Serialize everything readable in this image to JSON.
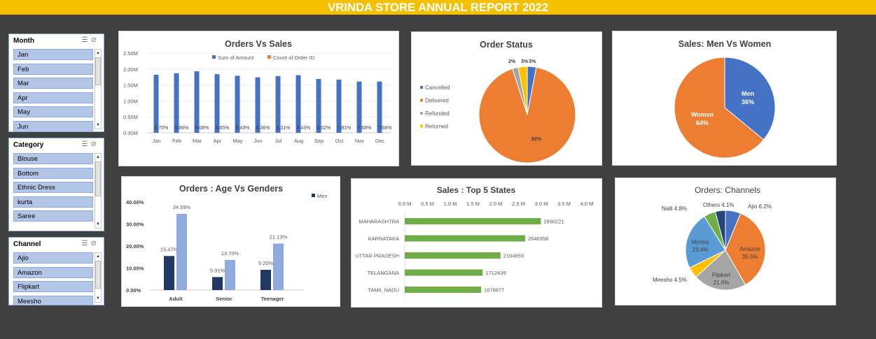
{
  "report": {
    "title": "VRINDA STORE ANNUAL REPORT 2022"
  },
  "colors": {
    "blue": "#4472c4",
    "orange": "#ed7d31",
    "gray": "#a5a5a5",
    "gold": "#ffc000",
    "navy": "#203864",
    "lightblue": "#8faadc",
    "green": "#70ad47",
    "header": "#f5c000",
    "background": "#404040"
  },
  "slicers": {
    "month": {
      "title": "Month",
      "items": [
        "Jan",
        "Feb",
        "Mar",
        "Apr",
        "May",
        "Jun"
      ]
    },
    "category": {
      "title": "Category",
      "items": [
        "Blouse",
        "Bottom",
        "Ethnic Dress",
        "kurta",
        "Saree"
      ]
    },
    "channel": {
      "title": "Channel",
      "items": [
        "Ajio",
        "Amazon",
        "Flipkart",
        "Meesho"
      ]
    }
  },
  "chart_data": [
    {
      "id": "orders_vs_sales",
      "type": "bar",
      "title": "Orders Vs Sales",
      "categories": [
        "Jan",
        "Feb",
        "Mar",
        "Apr",
        "May",
        "Jun",
        "Jul",
        "Aug",
        "Sep",
        "Oct",
        "Nov",
        "Dec"
      ],
      "series": [
        {
          "name": "Sum of Amount",
          "values": [
            1.82,
            1.87,
            1.93,
            1.84,
            1.79,
            1.74,
            1.78,
            1.81,
            1.69,
            1.67,
            1.61,
            1.61
          ]
        },
        {
          "name": "Count of Order ID",
          "values": [
            0,
            0,
            0,
            0,
            0,
            0,
            0,
            0,
            0,
            0,
            0,
            0
          ]
        }
      ],
      "data_labels": [
        "8.70%",
        "8.86%",
        "9.08%",
        "8.65%",
        "8.43%",
        "8.36%",
        "8.31%",
        "8.43%",
        "8.02%",
        "7.81%",
        "7.68%",
        "7.68%"
      ],
      "yticks": [
        "0.00M",
        "0.50M",
        "1.00M",
        "1.50M",
        "2.00M",
        "2.50M"
      ],
      "ylim": [
        0,
        2.5
      ],
      "legend": "top"
    },
    {
      "id": "order_status",
      "type": "pie",
      "title": "Order Status",
      "labels": [
        "Cancelled",
        "Delivered",
        "Refunded",
        "Returned"
      ],
      "values": [
        3,
        92,
        2,
        3
      ],
      "data_labels": [
        "3%",
        "92%",
        "2%",
        "3%"
      ],
      "legend": "left"
    },
    {
      "id": "sales_men_women",
      "type": "pie",
      "title": "Sales: Men Vs Women",
      "labels": [
        "Men",
        "Women"
      ],
      "values": [
        36,
        64
      ],
      "data_labels": [
        "36%",
        "64%"
      ]
    },
    {
      "id": "orders_age_gender",
      "type": "bar",
      "title": "Orders : Age Vs Genders",
      "categories": [
        "Adult",
        "Senior",
        "Teenager"
      ],
      "series": [
        {
          "name": "Men",
          "values": [
            15.47,
            5.91,
            9.2
          ],
          "labels": [
            "15.47%",
            "5.91%",
            "9.20%"
          ]
        },
        {
          "name": "",
          "values": [
            34.59,
            13.7,
            21.13
          ],
          "labels": [
            "34.59%",
            "13.70%",
            "21.13%"
          ]
        }
      ],
      "yticks": [
        "0.00%",
        "10.00%",
        "20.00%",
        "30.00%",
        "40.00%"
      ],
      "ylim": [
        0,
        40
      ],
      "legend": "top-right"
    },
    {
      "id": "top5_states",
      "type": "bar",
      "orientation": "horizontal",
      "title": "Sales : Top 5 States",
      "categories": [
        "MAHARASHTRA",
        "KARNATAKA",
        "UTTAR PRADESH",
        "TELANGANA",
        "TAMIL NADU"
      ],
      "values": [
        2990221,
        2646358,
        2104659,
        1712439,
        1678877
      ],
      "data_labels": [
        "2990221",
        "2646358",
        "2104659",
        "1712439",
        "1678877"
      ],
      "xticks": [
        "0.0 M",
        "0.5 M",
        "1.0 M",
        "1.5 M",
        "2.0 M",
        "2.5 M",
        "3.0 M",
        "3.5 M",
        "4.0 M"
      ],
      "xlim": [
        0,
        4000000
      ]
    },
    {
      "id": "orders_channels",
      "type": "pie",
      "title": "Orders: Channels",
      "labels": [
        "Ajio",
        "Amazon",
        "Flipkart",
        "Meesho",
        "Myntra",
        "Nalli",
        "Others"
      ],
      "values": [
        6.2,
        35.5,
        21.6,
        4.5,
        23.4,
        4.8,
        4.1
      ],
      "data_labels": [
        "Ajio 6.2%",
        "Amazon 35.5%",
        "Flipkart 21.6%",
        "Meesho 4.5%",
        "Myntra 23.4%",
        "Nalli 4.8%",
        "Others 4.1%"
      ]
    }
  ]
}
